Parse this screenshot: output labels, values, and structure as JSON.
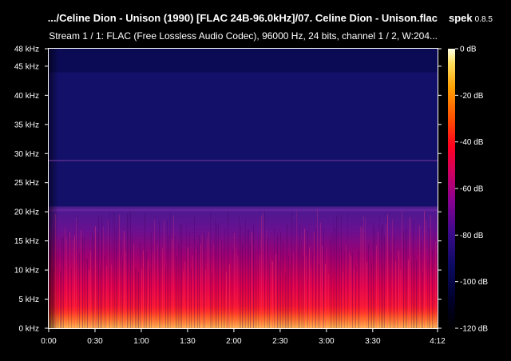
{
  "header": {
    "file_title": ".../Celine Dion - Unison (1990) [FLAC 24B-96.0kHz]/07. Celine Dion - Unison.flac",
    "app_name": "spek",
    "app_version": "0.8.5",
    "stream_info": "Stream 1 / 1: FLAC (Free Lossless Audio Codec), 96000 Hz, 24 bits, channel 1 / 2, W:204..."
  },
  "chart_data": {
    "type": "heatmap",
    "y_ticks": [
      "0 kHz",
      "5 kHz",
      "10 kHz",
      "15 kHz",
      "20 kHz",
      "25 kHz",
      "30 kHz",
      "35 kHz",
      "40 kHz",
      "45 kHz",
      "48 kHz"
    ],
    "y_tick_values": [
      0,
      5,
      10,
      15,
      20,
      25,
      30,
      35,
      40,
      45,
      48
    ],
    "ylim": [
      0,
      48
    ],
    "x_ticks": [
      "0:00",
      "0:30",
      "1:00",
      "1:30",
      "2:00",
      "2:30",
      "3:00",
      "3:30",
      "4:12"
    ],
    "x_tick_values": [
      0,
      30,
      60,
      90,
      120,
      150,
      180,
      210,
      252
    ],
    "xlim": [
      0,
      252
    ],
    "colorbar_ticks": [
      "0 dB",
      "-20 dB",
      "-40 dB",
      "-60 dB",
      "-80 dB",
      "-100 dB",
      "-120 dB"
    ],
    "colorbar_values": [
      0,
      -20,
      -40,
      -60,
      -80,
      -100,
      -120
    ],
    "cutoff_khz": 20.5,
    "noise_floor_top_khz": 44,
    "spur_line_khz": 28.8
  }
}
